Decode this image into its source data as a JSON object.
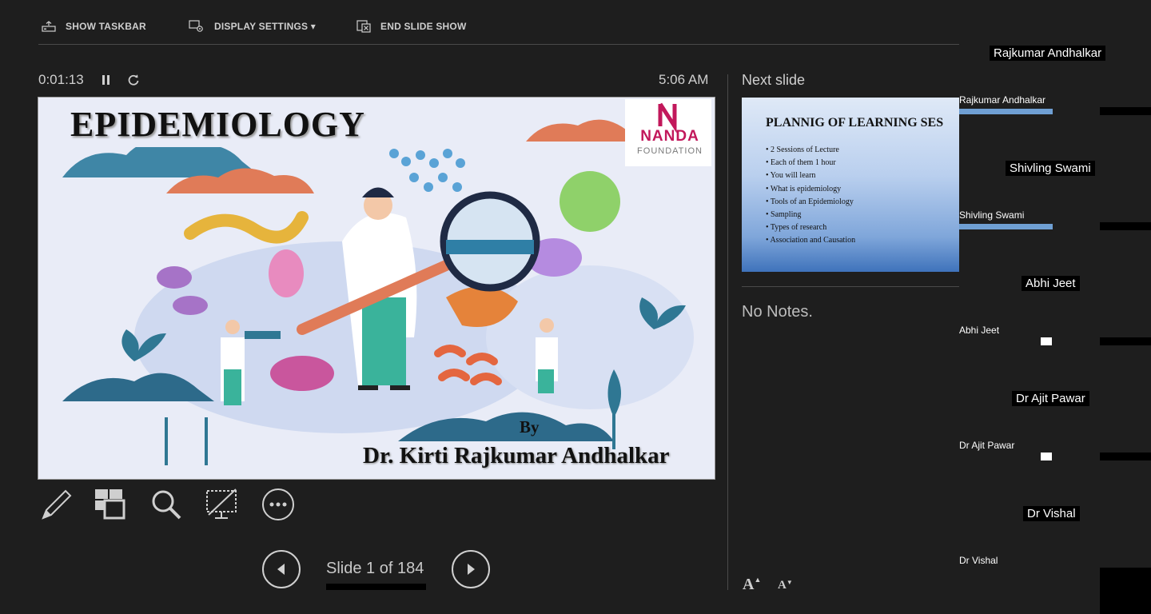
{
  "toolbar": {
    "show_taskbar": "SHOW TASKBAR",
    "display_settings": "DISPLAY SETTINGS ▾",
    "end_slide_show": "END SLIDE SHOW"
  },
  "timer": {
    "elapsed": "0:01:13",
    "clock": "5:06 AM"
  },
  "current_slide": {
    "title": "EPIDEMIOLOGY",
    "logo_line1": "NANDA",
    "logo_line2": "FOUNDATION",
    "by": "By",
    "author": "Dr. Kirti Rajkumar Andhalkar"
  },
  "navigation": {
    "slide_counter": "Slide 1 of 184"
  },
  "next_slide": {
    "label": "Next slide",
    "title": "PLANNIG OF LEARNING SES",
    "bullets": [
      "2 Sessions of Lecture",
      "Each of them 1 hour",
      "You will learn",
      "What is epidemiology",
      "Tools of an Epidemiology",
      "Sampling",
      "Types of research",
      "Association and Causation"
    ]
  },
  "notes": {
    "text": "No Notes."
  },
  "font_controls": {
    "increase": "A",
    "decrease": "A"
  },
  "participants": [
    {
      "name": "Rajkumar Andhalkar",
      "small": "Rajkumar Andhalkar"
    },
    {
      "name": "Shivling Swami",
      "small": "Shivling Swami"
    },
    {
      "name": "Abhi Jeet",
      "small": "Abhi Jeet"
    },
    {
      "name": "Dr Ajit Pawar",
      "small": "Dr Ajit Pawar"
    },
    {
      "name": "Dr Vishal",
      "small": "Dr Vishal"
    }
  ],
  "colors": {
    "background": "#1e1e1e",
    "slide_background": "#e9ecf7",
    "accent_pink": "#c2185b",
    "next_slide_blue": "#3f73bb"
  }
}
